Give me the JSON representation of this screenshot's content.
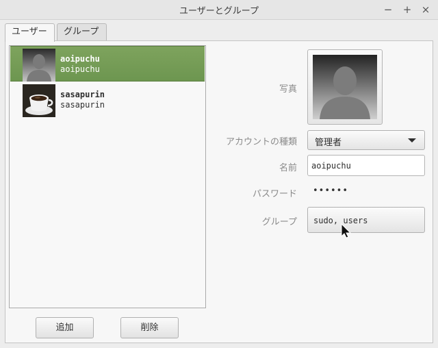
{
  "window": {
    "title": "ユーザーとグループ",
    "minimize": "−",
    "maximize": "+",
    "close": "×"
  },
  "tabs": [
    {
      "label": "ユーザー",
      "active": true
    },
    {
      "label": "グループ",
      "active": false
    }
  ],
  "users": [
    {
      "display_name": "aoipuchu",
      "username": "aoipuchu",
      "avatar": "silhouette-icon",
      "selected": true
    },
    {
      "display_name": "sasapurin",
      "username": "sasapurin",
      "avatar": "coffee-cup-icon",
      "selected": false
    }
  ],
  "buttons": {
    "add": "追加",
    "remove": "削除"
  },
  "details": {
    "photo_label": "写真",
    "account_type_label": "アカウントの種類",
    "account_type_value": "管理者",
    "name_label": "名前",
    "name_value": "aoipuchu",
    "password_label": "パスワード",
    "password_value": "••••••",
    "groups_label": "グループ",
    "groups_value": "sudo, users"
  },
  "colors": {
    "selection": "#76a056",
    "window_bg": "#ededed"
  }
}
